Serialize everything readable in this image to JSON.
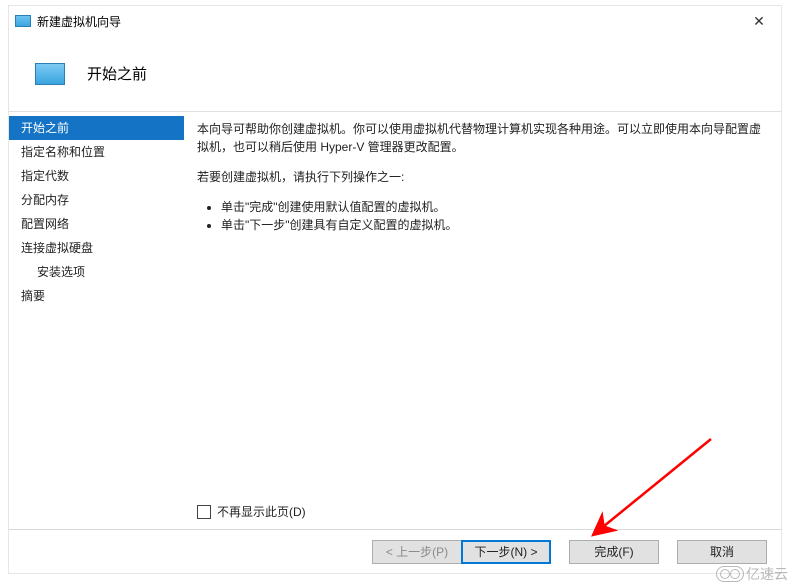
{
  "window": {
    "title": "新建虚拟机向导",
    "close_label": "✕"
  },
  "header": {
    "heading": "开始之前"
  },
  "sidebar": {
    "steps": [
      {
        "label": "开始之前",
        "selected": true,
        "sub": false
      },
      {
        "label": "指定名称和位置",
        "selected": false,
        "sub": false
      },
      {
        "label": "指定代数",
        "selected": false,
        "sub": false
      },
      {
        "label": "分配内存",
        "selected": false,
        "sub": false
      },
      {
        "label": "配置网络",
        "selected": false,
        "sub": false
      },
      {
        "label": "连接虚拟硬盘",
        "selected": false,
        "sub": false
      },
      {
        "label": "安装选项",
        "selected": false,
        "sub": true
      },
      {
        "label": "摘要",
        "selected": false,
        "sub": false
      }
    ]
  },
  "content": {
    "intro": "本向导可帮助你创建虚拟机。你可以使用虚拟机代替物理计算机实现各种用途。可以立即使用本向导配置虚拟机，也可以稍后使用 Hyper-V 管理器更改配置。",
    "prompt": "若要创建虚拟机，请执行下列操作之一:",
    "bullets": [
      "单击\"完成\"创建使用默认值配置的虚拟机。",
      "单击\"下一步\"创建具有自定义配置的虚拟机。"
    ],
    "dont_show_label": "不再显示此页(D)"
  },
  "footer": {
    "prev": "< 上一步(P)",
    "next": "下一步(N) >",
    "finish": "完成(F)",
    "cancel": "取消"
  },
  "watermark": {
    "text": "亿速云"
  }
}
